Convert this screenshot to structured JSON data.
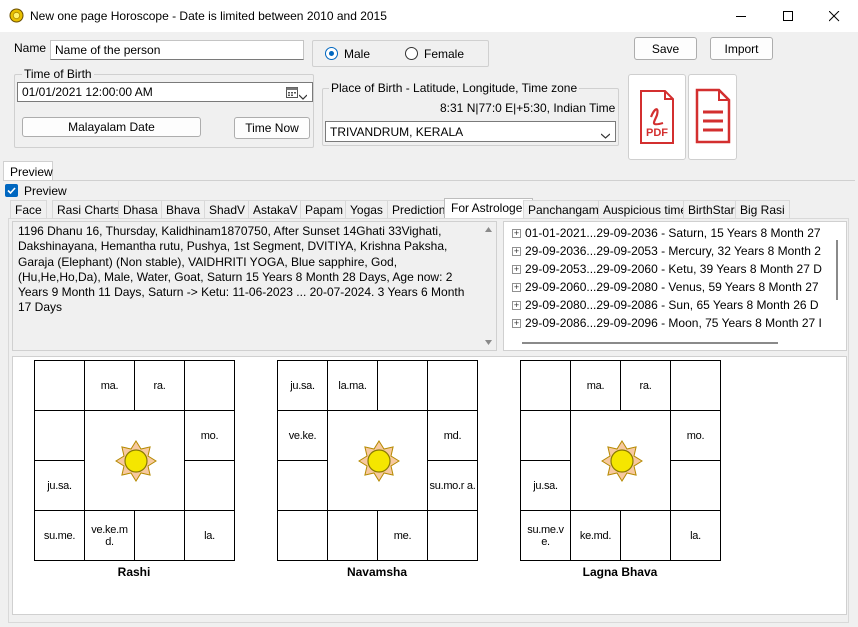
{
  "window": {
    "title": "New one page Horoscope - Date is limited between 2010 and 2015"
  },
  "form": {
    "name_label": "Name",
    "name_value": "Name of the person",
    "gender_male": "Male",
    "gender_female": "Female",
    "save_label": "Save",
    "import_label": "Import",
    "time_of_birth_label": "Time of Birth",
    "datetime_value": "01/01/2021  12:00:00 AM",
    "malayalam_date_label": "Malayalam Date",
    "time_now_label": "Time Now",
    "place_label": "Place of Birth - Latitude, Longitude, Time zone",
    "coords": "8:31 N|77:0 E|+5:30, Indian Time",
    "place_value": "TRIVANDRUM, KERALA",
    "pdf_label": "PDF"
  },
  "preview": {
    "tab_label": "Preview",
    "checkbox_label": "Preview"
  },
  "tabs": [
    "Face",
    "Rasi Charts",
    "Dhasa",
    "Bhava",
    "ShadV",
    "AstakaV",
    "Papam",
    "Yogas",
    "Prediction",
    "For Astrologer",
    "Panchangam",
    "Auspicious time",
    "BirthStar",
    "Big Rasi"
  ],
  "selected_tab": "For Astrologer",
  "details_text": "1196 Dhanu  16, Thursday, Kalidhinam1870750, After Sunset 14Ghati 33Vighati, Dakshinayana, Hemantha rutu, Pushya, 1st Segment, DVITIYA, Krishna Paksha, Garaja (Elephant) (Non stable), VAIDHRITI YOGA, Blue sapphire, God, (Hu,He,Ho,Da), Male, Water, Goat, Saturn 15 Years 8 Month 28 Days, Age now: 2 Years 9 Month 11 Days, Saturn -> Ketu: 11-06-2023 ... 20-07-2024.  3 Years 6 Month 17 Days",
  "dasha_tree": [
    "01-01-2021...29-09-2036 - Saturn, 15 Years 8 Month 27",
    "29-09-2036...29-09-2053 - Mercury, 32 Years 8 Month 2",
    "29-09-2053...29-09-2060 - Ketu, 39 Years 8 Month 27 D",
    "29-09-2060...29-09-2080 - Venus, 59 Years 8 Month 27",
    "29-09-2080...29-09-2086 - Sun, 65 Years 8 Month 26 D",
    "29-09-2086...29-09-2096 - Moon, 75 Years 8 Month 27 I"
  ],
  "charts": [
    {
      "title": "Rashi",
      "houses": {
        "pisces": "",
        "aries": "ma.",
        "taurus": "ra.",
        "gemini": "",
        "aquarius": "",
        "cancer": "mo.",
        "capricorn": "ju.sa.",
        "leo": "",
        "sagittarius": "su.me.",
        "scorpio": "ve.ke.m d.",
        "libra": "",
        "virgo": "la."
      }
    },
    {
      "title": "Navamsha",
      "houses": {
        "pisces": "ju.sa.",
        "aries": "la.ma.",
        "taurus": "",
        "gemini": "",
        "aquarius": "ve.ke.",
        "cancer": "md.",
        "capricorn": "",
        "leo": "su.mo.r a.",
        "sagittarius": "",
        "scorpio": "",
        "libra": "me.",
        "virgo": ""
      }
    },
    {
      "title": "Lagna Bhava",
      "houses": {
        "pisces": "",
        "aries": "ma.",
        "taurus": "ra.",
        "gemini": "",
        "aquarius": "",
        "cancer": "mo.",
        "capricorn": "ju.sa.",
        "leo": "",
        "sagittarius": "su.me.v e.",
        "scorpio": "ke.md.",
        "libra": "",
        "virgo": "la."
      }
    }
  ],
  "colors": {
    "accent": "#0067c0",
    "pdf_red": "#d32f2f",
    "sun_yellow": "#f5e600"
  }
}
